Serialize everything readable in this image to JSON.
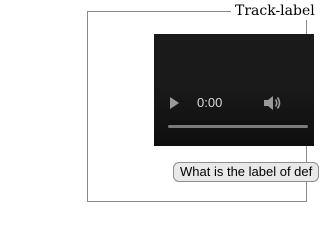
{
  "fieldset": {
    "legend": "Track-label"
  },
  "video": {
    "time": "0:00",
    "progress": 0,
    "play_icon": "play-icon",
    "volume_icon": "volume-icon"
  },
  "button": {
    "label": "What is the label of def"
  },
  "colors": {
    "video_background": "#1a1a1a",
    "controls_foreground": "#d8d8d8",
    "button_background": "#e9e9e9"
  }
}
